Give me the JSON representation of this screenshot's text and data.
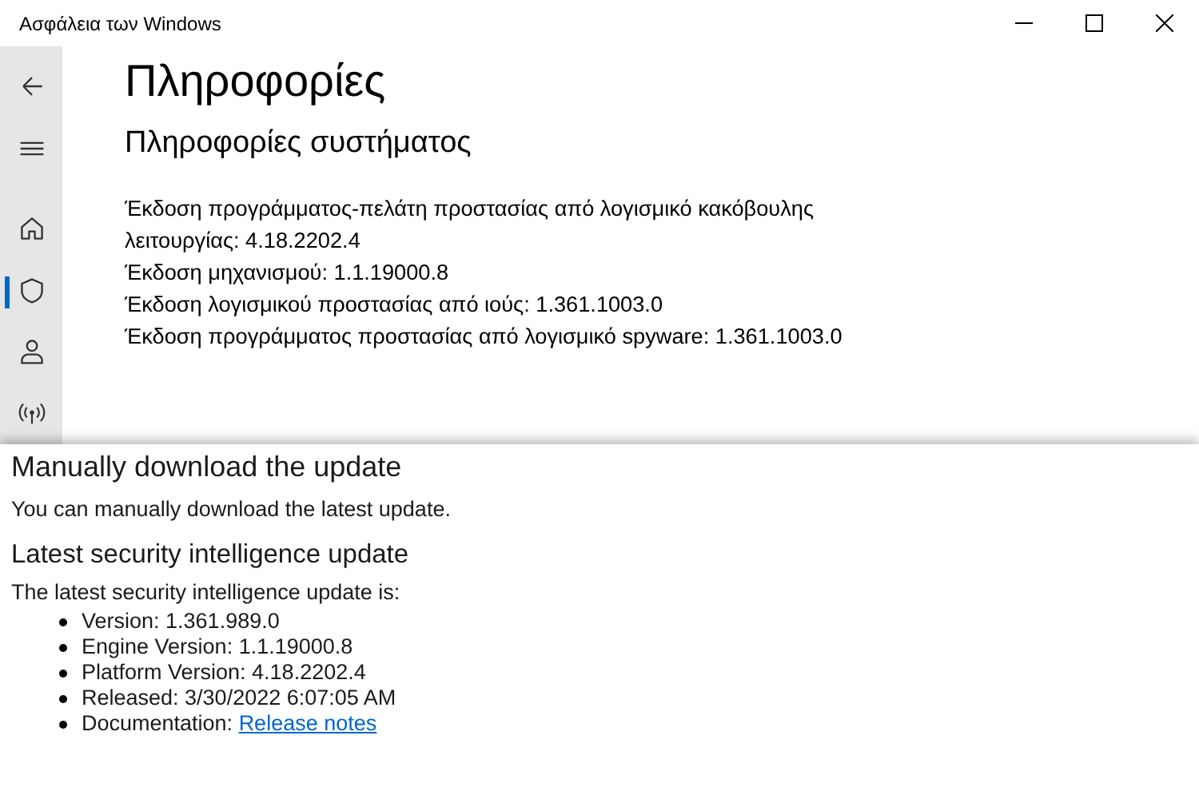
{
  "window": {
    "title": "Ασφάλεια των Windows"
  },
  "nav": [
    {
      "kind": "back",
      "selected": false
    },
    {
      "kind": "menu",
      "selected": false
    },
    {
      "kind": "home",
      "selected": false
    },
    {
      "kind": "shield",
      "selected": true
    },
    {
      "kind": "person",
      "selected": false
    },
    {
      "kind": "wireless",
      "selected": false
    }
  ],
  "page": {
    "title": "Πληροφορίες",
    "subtitle": "Πληροφορίες συστήματος",
    "lines": [
      "Έκδοση προγράμματος-πελάτη προστασίας από λογισμικό κακόβουλης λειτουργίας: 4.18.2202.4",
      "Έκδοση μηχανισμού: 1.1.19000.8",
      "Έκδοση λογισμικού προστασίας από ιούς: 1.361.1003.0",
      "Έκδοση προγράμματος προστασίας από λογισμικό spyware: 1.361.1003.0"
    ]
  },
  "web": {
    "heading": "Manually download the update",
    "text": "You can manually download the latest update.",
    "subheading": "Latest security intelligence update",
    "intro": "The latest security intelligence update is:",
    "items": [
      {
        "label": "Version: 1.361.989.0"
      },
      {
        "label": "Engine Version: 1.1.19000.8"
      },
      {
        "label": "Platform Version: 4.18.2202.4"
      },
      {
        "label": "Released: 3/30/2022 6:07:05 AM"
      },
      {
        "label": "Documentation: ",
        "link": "Release notes"
      }
    ]
  }
}
